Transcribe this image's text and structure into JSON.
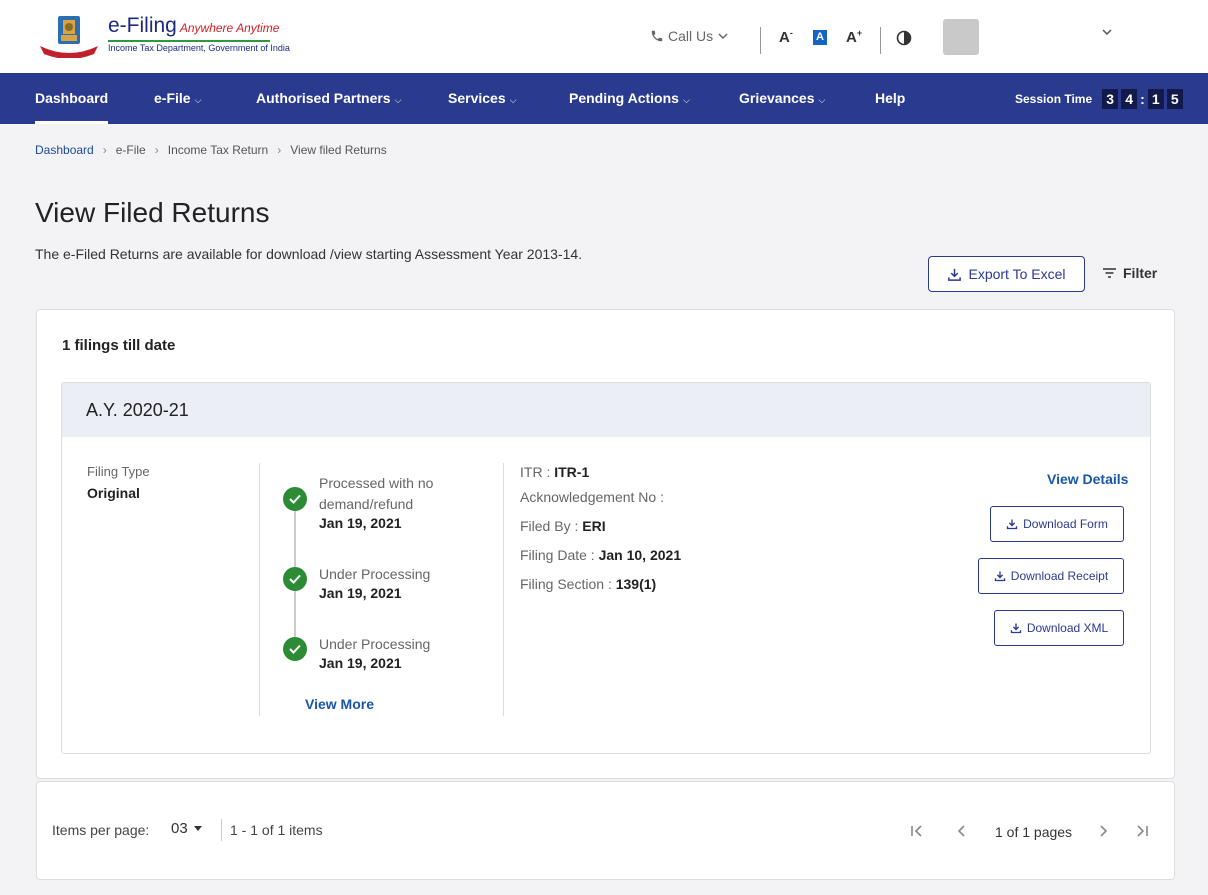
{
  "header": {
    "brand": "e-Filing",
    "tagline": "Anywhere Anytime",
    "department": "Income Tax Department, Government of India",
    "call_us": "Call Us",
    "font_decrease": "A",
    "font_normal": "A",
    "font_increase": "A"
  },
  "nav": {
    "items": [
      "Dashboard",
      "e-File",
      "Authorised Partners",
      "Services",
      "Pending Actions",
      "Grievances",
      "Help"
    ],
    "session_label": "Session Time",
    "session_digits": [
      "3",
      "4",
      "1",
      "5"
    ]
  },
  "breadcrumb": [
    "Dashboard",
    "e-File",
    "Income Tax Return",
    "View filed Returns"
  ],
  "page": {
    "title": "View Filed Returns",
    "subtitle": "The e-Filed Returns are available for download /view starting Assessment Year 2013-14.",
    "export_label": "Export To Excel",
    "filter_label": "Filter",
    "count_text": "1 filings till date"
  },
  "filing": {
    "ay": "A.Y. 2020-21",
    "filing_type_label": "Filing Type",
    "filing_type_value": "Original",
    "timeline": [
      {
        "status": "Processed with no demand/refund",
        "date": "Jan 19, 2021"
      },
      {
        "status": "Under Processing",
        "date": "Jan 19, 2021"
      },
      {
        "status": "Under Processing",
        "date": "Jan 19, 2021"
      }
    ],
    "view_more": "View More",
    "itr_label": "ITR :",
    "itr_value": "ITR-1",
    "ack_label": "Acknowledgement No :",
    "filed_by_label": "Filed By :",
    "filed_by_value": "ERI",
    "filing_date_label": "Filing Date :",
    "filing_date_value": "Jan 10, 2021",
    "filing_section_label": "Filing Section :",
    "filing_section_value": "139(1)",
    "view_details": "View Details",
    "download_form": "Download Form",
    "download_receipt": "Download Receipt",
    "download_xml": "Download XML"
  },
  "pagination": {
    "items_per_page_label": "Items per page:",
    "items_per_page_value": "03",
    "range": "1 - 1 of 1 items",
    "pages": "1 of 1 pages"
  },
  "colors": {
    "nav_bg": "#2a3a8f",
    "accent_link": "#1a56a8",
    "success": "#2e8b35"
  }
}
